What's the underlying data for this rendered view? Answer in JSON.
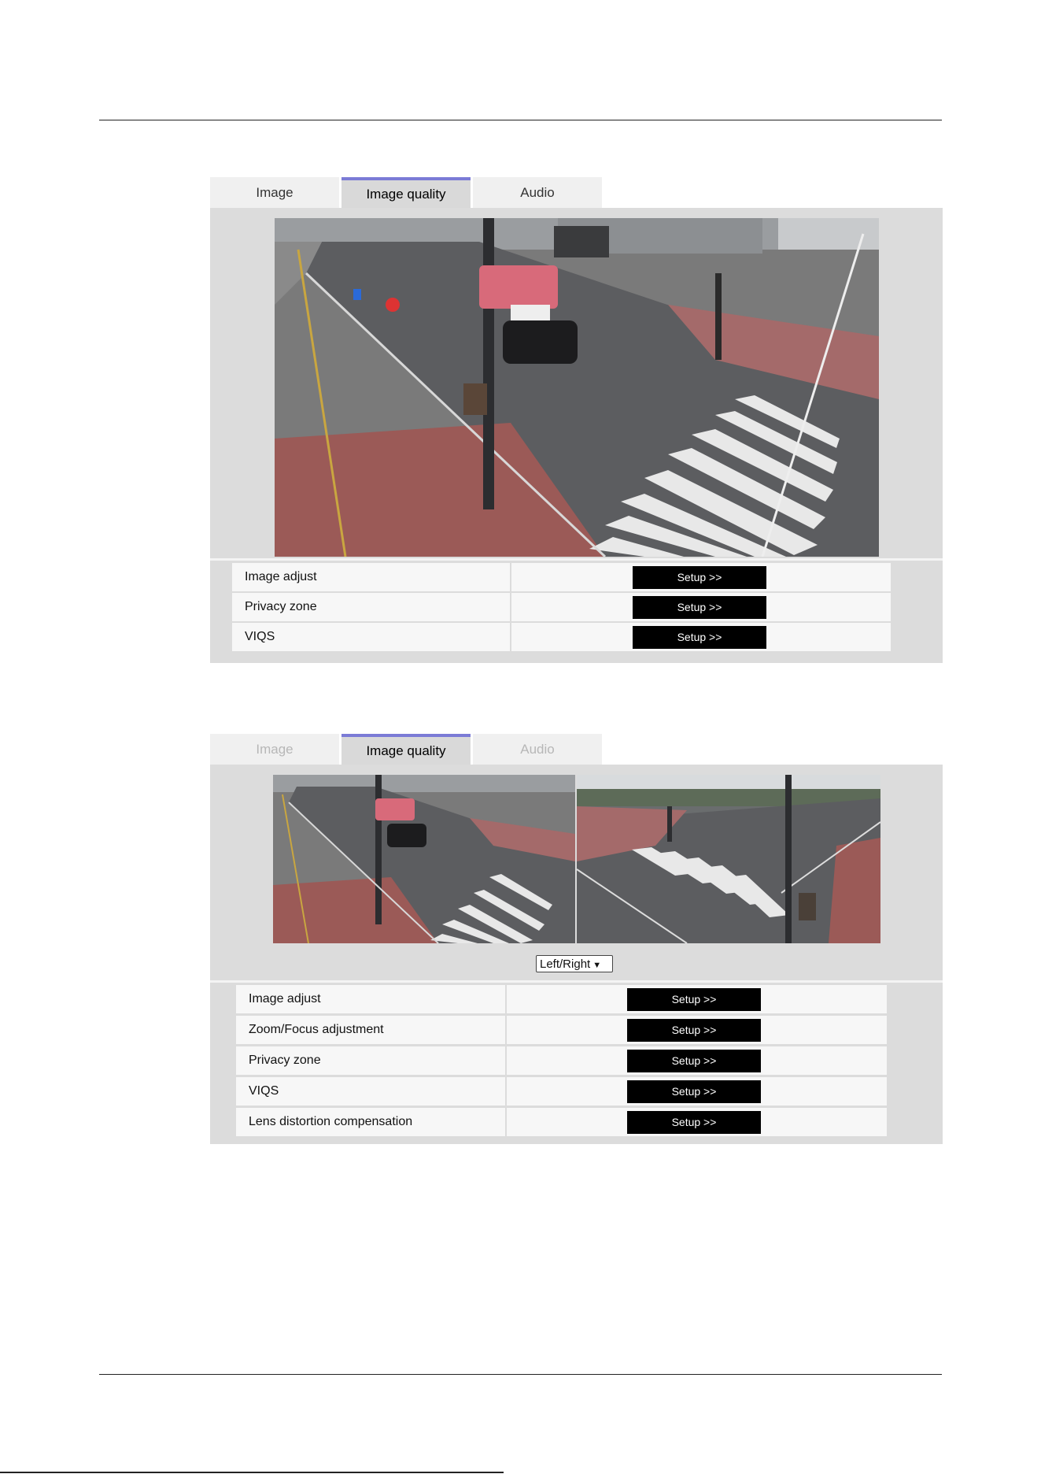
{
  "screen1": {
    "tabs": [
      {
        "label": "Image",
        "state": "normal"
      },
      {
        "label": "Image quality",
        "state": "active"
      },
      {
        "label": "Audio",
        "state": "normal"
      }
    ],
    "rows": [
      {
        "label": "Image adjust",
        "button": "Setup >>"
      },
      {
        "label": "Privacy zone",
        "button": "Setup >>"
      },
      {
        "label": "VIQS",
        "button": "Setup >>"
      }
    ]
  },
  "screen2": {
    "tabs": [
      {
        "label": "Image",
        "state": "disabled"
      },
      {
        "label": "Image quality",
        "state": "active"
      },
      {
        "label": "Audio",
        "state": "disabled"
      }
    ],
    "view_select": {
      "value": "Left/Right"
    },
    "rows": [
      {
        "label": "Image adjust",
        "button": "Setup >>"
      },
      {
        "label": "Zoom/Focus adjustment",
        "button": "Setup >>"
      },
      {
        "label": "Privacy zone",
        "button": "Setup >>"
      },
      {
        "label": "VIQS",
        "button": "Setup >>"
      },
      {
        "label": "Lens distortion compensation",
        "button": "Setup >>"
      }
    ]
  },
  "colors": {
    "tab_active_border": "#7b7bd6",
    "panel_bg": "#dcdcdc",
    "button_bg": "#000000"
  }
}
